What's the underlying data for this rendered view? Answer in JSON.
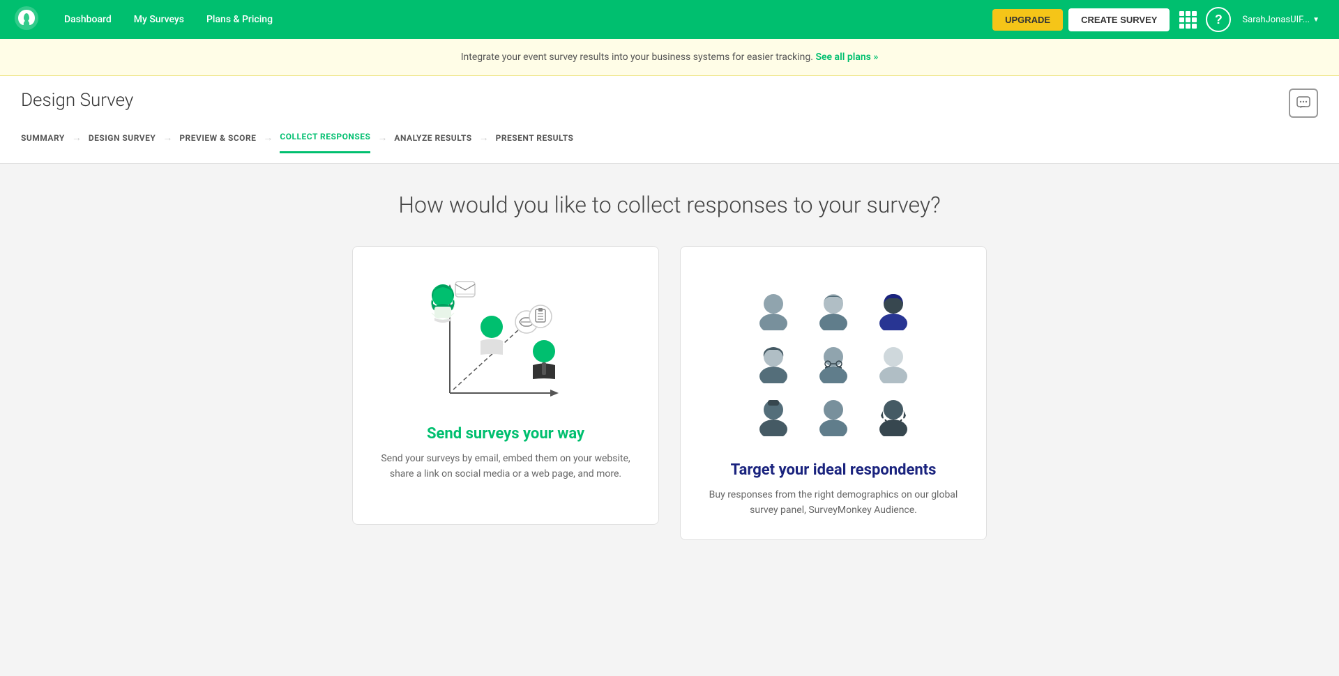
{
  "navbar": {
    "logo_alt": "SurveyMonkey Logo",
    "links": [
      {
        "label": "Dashboard",
        "name": "dashboard"
      },
      {
        "label": "My Surveys",
        "name": "my-surveys"
      },
      {
        "label": "Plans & Pricing",
        "name": "plans-pricing"
      }
    ],
    "upgrade_label": "UPGRADE",
    "create_survey_label": "CREATE SURVEY",
    "help_icon": "?",
    "user_name": "SarahJonasUIF...",
    "grid_icon": "apps-icon"
  },
  "banner": {
    "text": "Integrate your event survey results into your business systems for easier tracking.",
    "link_text": "See all plans »"
  },
  "page": {
    "title": "Design Survey",
    "chat_icon": "chat-icon"
  },
  "breadcrumbs": [
    {
      "label": "SUMMARY",
      "state": "inactive",
      "name": "summary"
    },
    {
      "label": "DESIGN SURVEY",
      "state": "inactive",
      "name": "design-survey"
    },
    {
      "label": "PREVIEW & SCORE",
      "state": "inactive",
      "name": "preview-score"
    },
    {
      "label": "COLLECT RESPONSES",
      "state": "active",
      "name": "collect-responses"
    },
    {
      "label": "ANALYZE RESULTS",
      "state": "inactive",
      "name": "analyze-results"
    },
    {
      "label": "PRESENT RESULTS",
      "state": "inactive",
      "name": "present-results"
    }
  ],
  "main": {
    "section_title": "How would you like to collect responses to your survey?",
    "card1": {
      "heading": "Send surveys your way",
      "description": "Send your surveys by email, embed them on your website, share a link on social media or a web page, and more.",
      "name": "send-surveys-card"
    },
    "card2": {
      "heading": "Target your ideal respondents",
      "description": "Buy responses from the right demographics on our global survey panel, SurveyMonkey Audience.",
      "name": "target-respondents-card"
    }
  }
}
